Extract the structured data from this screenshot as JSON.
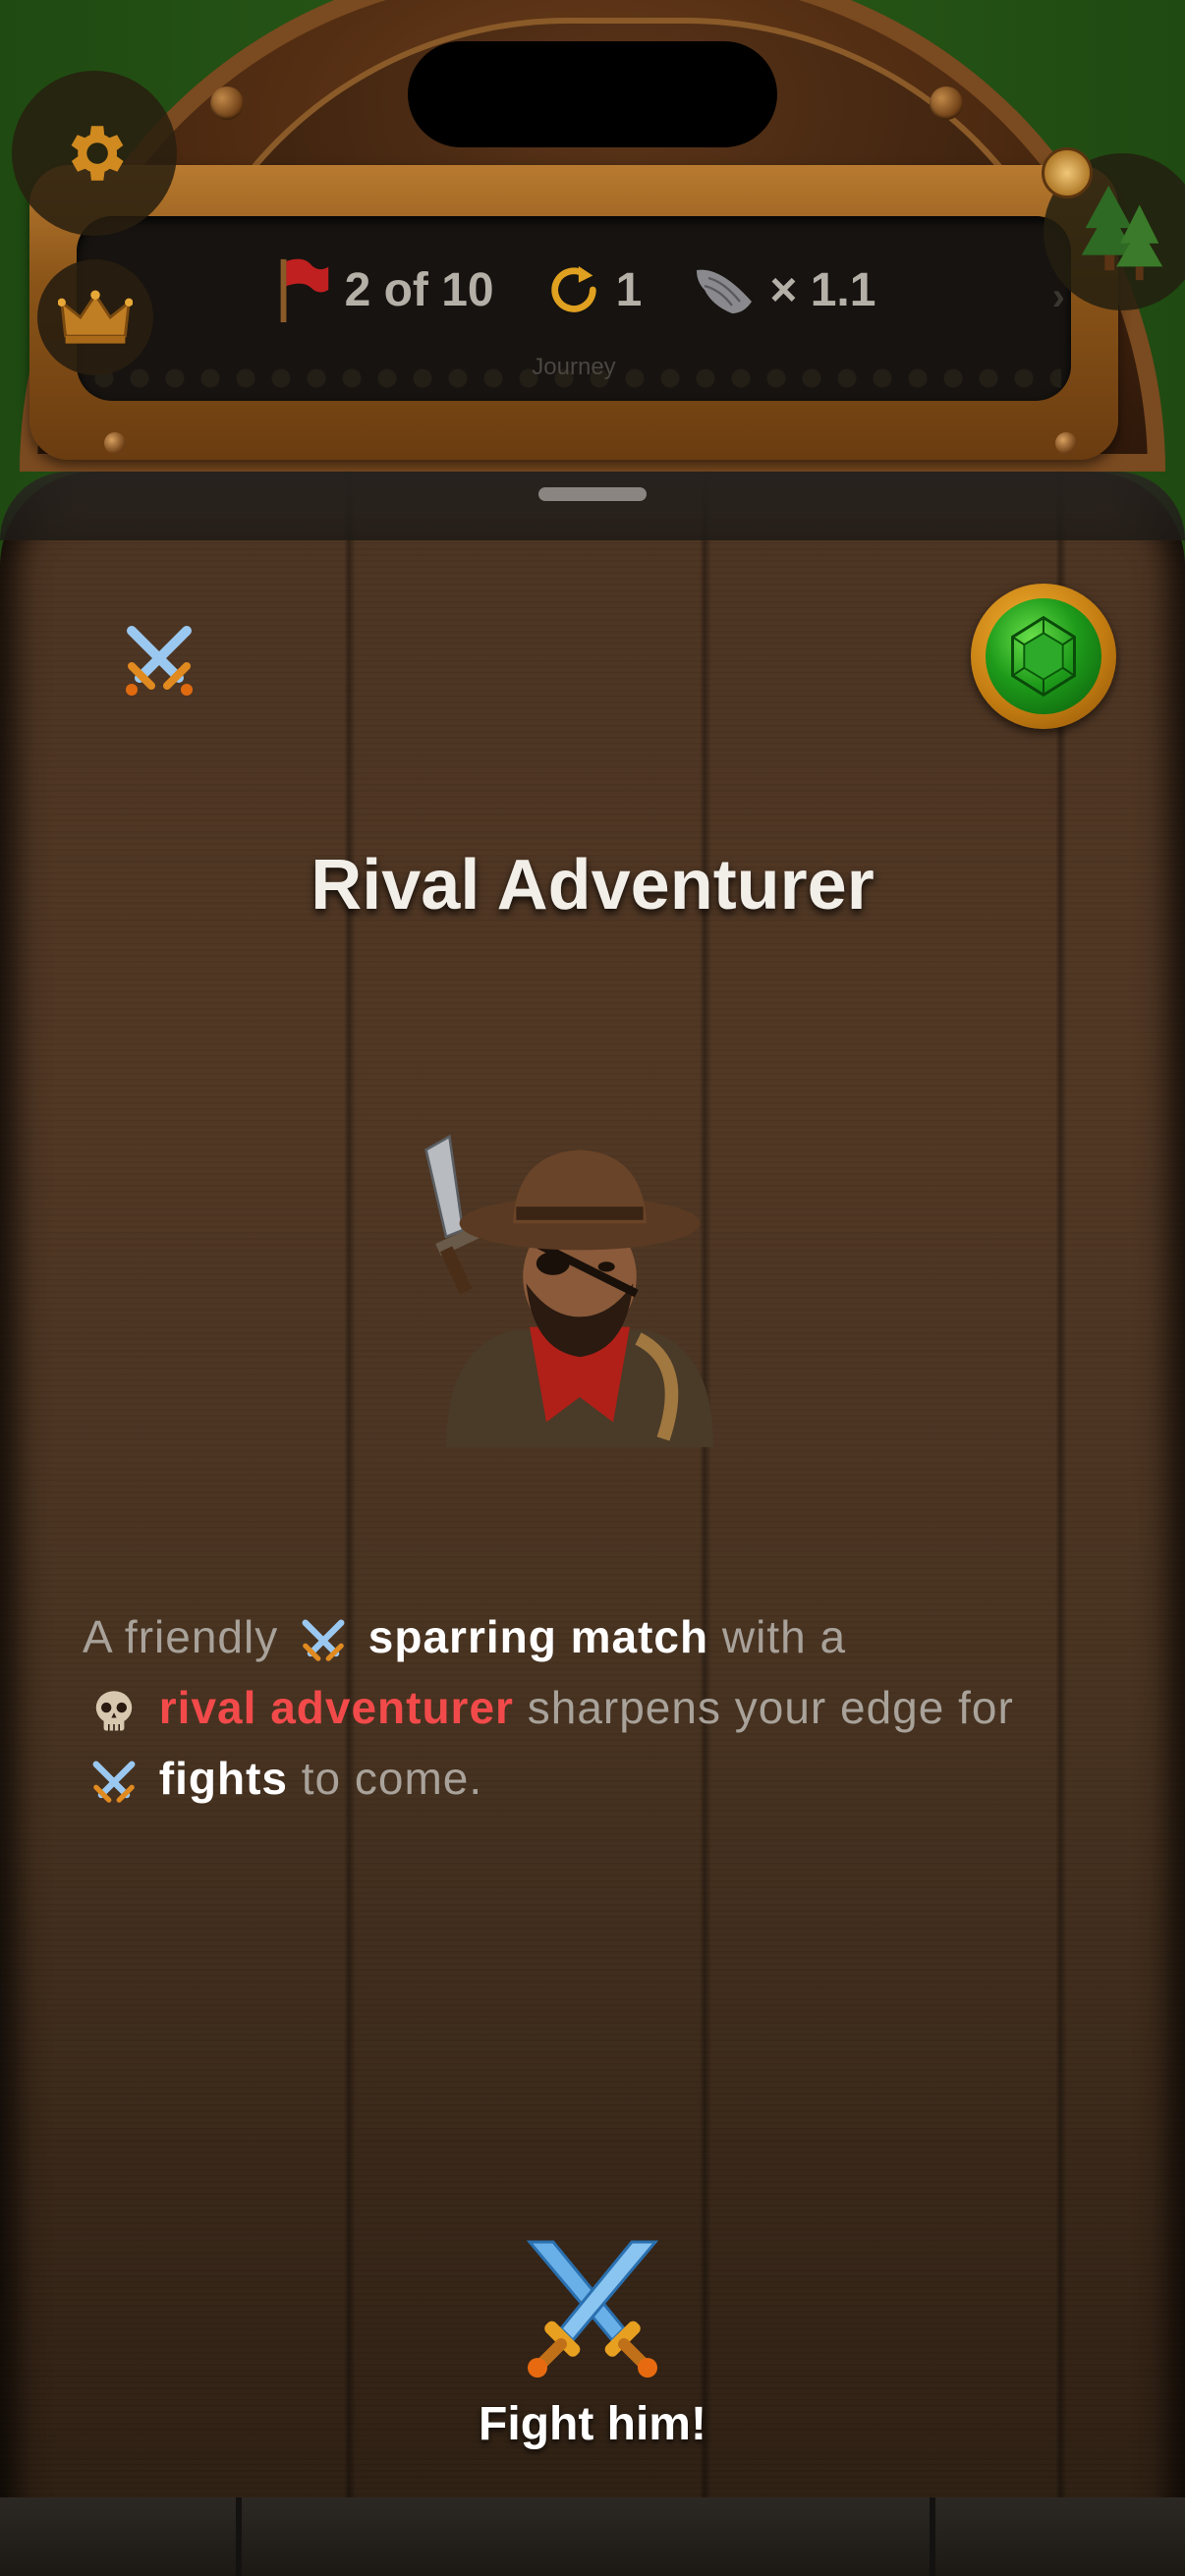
{
  "journey": {
    "progress_text": "2 of 10",
    "retries": "1",
    "multiplier": "× 1.1",
    "label": "Journey"
  },
  "encounter": {
    "title": "Rival Adventurer",
    "description": {
      "part1": "A friendly",
      "highlight1": "sparring match",
      "part2": "with a",
      "highlight2": "rival adventurer",
      "part3": "sharpens your edge for",
      "highlight3": "fights",
      "part4": "to come."
    },
    "action_label": "Fight him!"
  },
  "icons": {
    "settings": "gear-icon",
    "leaderboard": "crown-icon",
    "map": "pine-tree-icon",
    "compass": "compass-icon",
    "progress": "flag-icon",
    "retries": "refresh-icon",
    "multiplier": "wing-icon",
    "encounter_type": "crossed-swords-icon",
    "reward": "emerald-gem-icon",
    "enemy": "skull-icon"
  },
  "colors": {
    "wood": "#4a3220",
    "brass": "#b87a30",
    "enemy_red": "#f24a4a",
    "emerald": "#1e9a1a",
    "gold": "#f4b030"
  }
}
